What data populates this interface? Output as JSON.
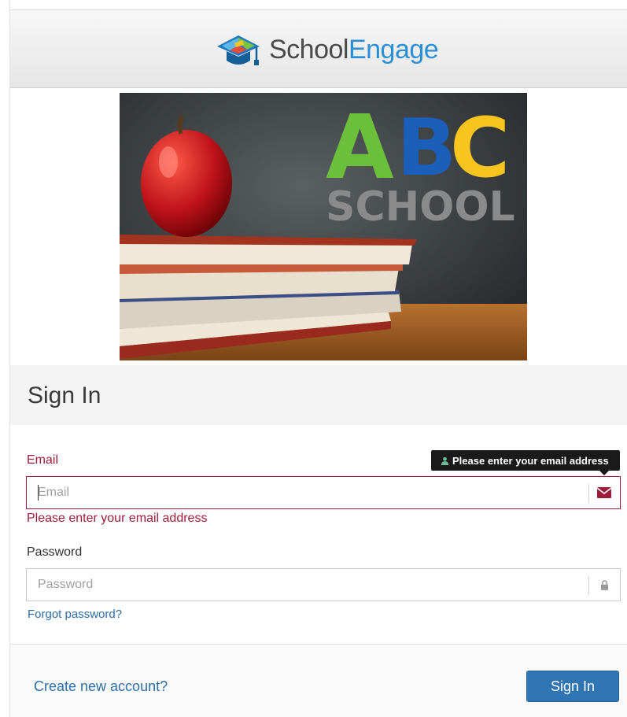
{
  "header": {
    "brand_part1": "School",
    "brand_part2": "Engage"
  },
  "hero": {
    "sign_letters": [
      "A",
      "B",
      "C"
    ],
    "sign_word": "SCHOOL"
  },
  "signin": {
    "title": "Sign In",
    "email": {
      "label": "Email",
      "placeholder": "Email",
      "error": "Please enter your email address",
      "tooltip": "Please enter your email address",
      "icon": "envelope-icon"
    },
    "password": {
      "label": "Password",
      "placeholder": "Password",
      "icon": "lock-icon"
    },
    "forgot_link": "Forgot password?",
    "create_link": "Create new account?",
    "submit_label": "Sign In"
  },
  "colors": {
    "error": "#9c1c3c",
    "primary": "#2f74b3",
    "link": "#2b6ea8",
    "brand_accent": "#2a8fd4"
  }
}
